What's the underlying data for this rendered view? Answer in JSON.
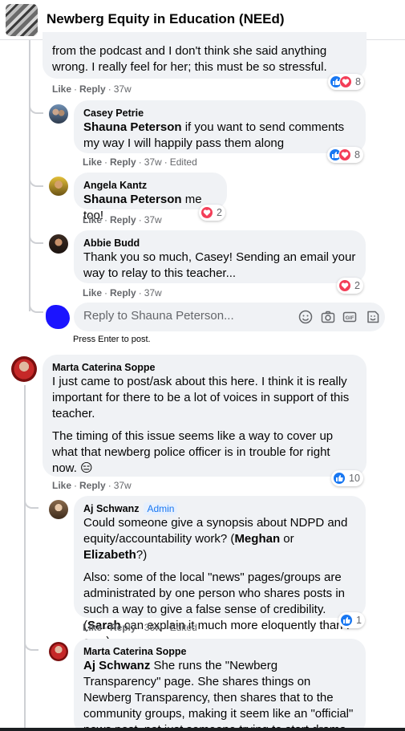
{
  "header": {
    "group_name": "Newberg Equity in Education (NEEd)"
  },
  "comments": [
    {
      "author": "",
      "text": "from the podcast and I don't think she said anything wrong. I really feel for her; this must be so stressful.",
      "actions": {
        "like": "Like",
        "reply": "Reply",
        "time": "37w"
      },
      "reactions": {
        "types": [
          "like",
          "love"
        ],
        "count": "8"
      }
    },
    {
      "author": "Casey Petrie",
      "mention": "Shauna Peterson",
      "text": " if you want to send comments my way I will happily pass them along",
      "actions": {
        "like": "Like",
        "reply": "Reply",
        "time": "37w",
        "edited": "Edited"
      },
      "reactions": {
        "types": [
          "like",
          "love"
        ],
        "count": "8"
      }
    },
    {
      "author": "Angela Kantz",
      "mention": "Shauna Peterson",
      "text": " me too!",
      "actions": {
        "like": "Like",
        "reply": "Reply",
        "time": "37w"
      },
      "reactions": {
        "types": [
          "love"
        ],
        "count": "2"
      }
    },
    {
      "author": "Abbie Budd",
      "text": "Thank you so much, Casey! Sending an email your way to relay to this teacher...",
      "actions": {
        "like": "Like",
        "reply": "Reply",
        "time": "37w"
      },
      "reactions": {
        "types": [
          "love"
        ],
        "count": "2"
      }
    },
    {
      "author": "Marta Caterina Soppe",
      "para1": "I just came to post/ask about this here. I think it is really important for there to be a lot of voices in support of this teacher.",
      "para2": "The timing of this issue seems like a way to cover up what that newberg police officer is in trouble for right now. 😑",
      "actions": {
        "like": "Like",
        "reply": "Reply",
        "time": "37w"
      },
      "reactions": {
        "types": [
          "like"
        ],
        "count": "10"
      }
    },
    {
      "author": "Aj Schwanz",
      "badge": "Admin",
      "para1_a": "Could someone give a synopsis about NDPD and equity/accountability work? (",
      "para1_m1": "Meghan",
      "para1_b": " or ",
      "para1_m2": "Elizabeth",
      "para1_c": "?)",
      "para2_a": "Also: some of the local \"news\" pages/groups are administrated by one person who shares posts in such a way to give a false sense of credibility.(",
      "para2_m": "Sarah",
      "para2_b": " can explain it much more eloquently than I can.)",
      "actions": {
        "like": "Like",
        "reply": "Reply",
        "time": "36w",
        "edited": "Edited"
      },
      "reactions": {
        "types": [
          "like"
        ],
        "count": "1"
      }
    },
    {
      "author": "Marta Caterina Soppe",
      "mention": "Aj Schwanz",
      "text": " She runs the \"Newberg Transparency\" page. She shares things on Newberg Transparency, then shares that to the community groups, making it seem like an \"official\" news post, not just someone trying to start drama."
    }
  ],
  "reply_box": {
    "placeholder": "Reply to Shauna Peterson...",
    "hint": "Press Enter to post.",
    "icons": [
      "emoji-icon",
      "camera-icon",
      "gif-icon",
      "sticker-icon"
    ]
  },
  "colors": {
    "bubble": "#f0f2f5",
    "like": "#1877f2",
    "love": "#f33e58",
    "meta": "#65676b"
  }
}
